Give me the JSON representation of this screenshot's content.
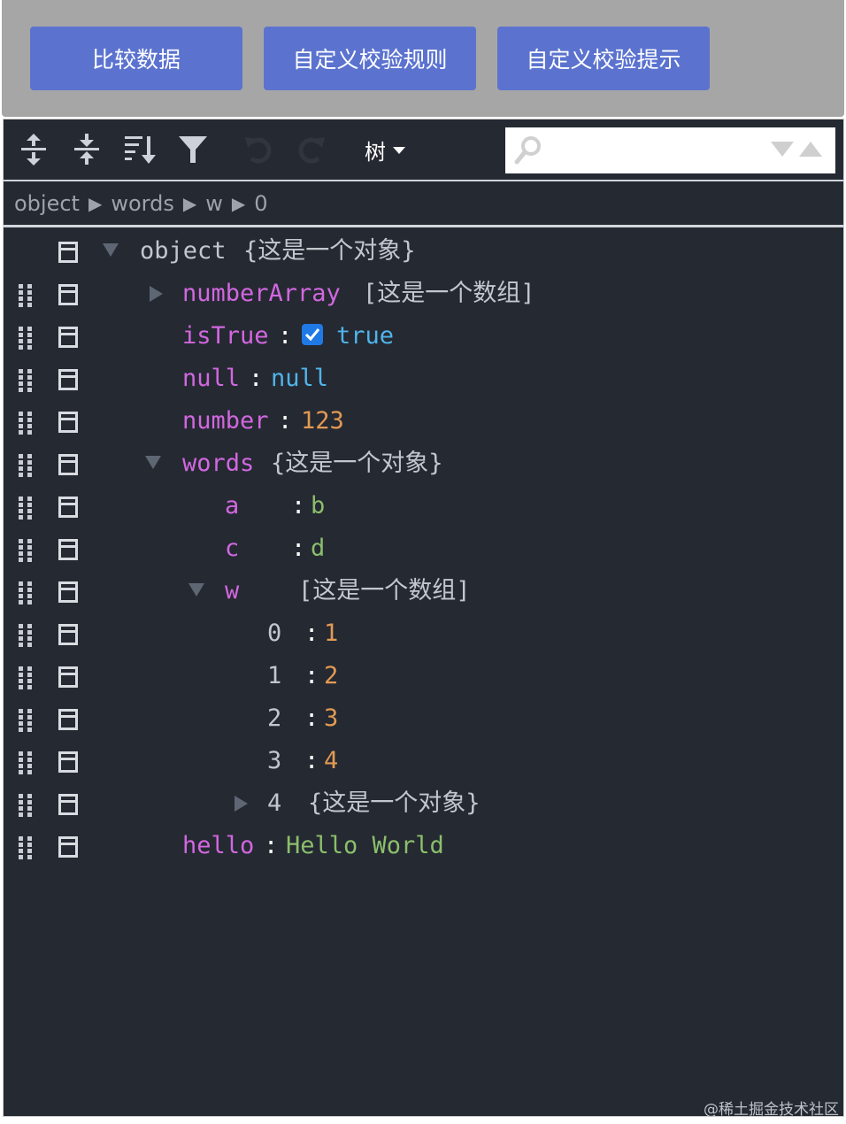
{
  "buttons": {
    "compare": "比较数据",
    "custom_rules": "自定义校验规则",
    "custom_hints": "自定义校验提示"
  },
  "menu": {
    "mode_label": "树",
    "search_placeholder": "",
    "icons": [
      "expand-all-icon",
      "collapse-all-icon",
      "sort-icon",
      "filter-icon",
      "undo-icon",
      "redo-icon"
    ]
  },
  "breadcrumb": [
    "object",
    "words",
    "w",
    "0"
  ],
  "breadcrumb_separator": "▶",
  "tree": {
    "root_key": "object",
    "root_desc": "{这是一个对象}",
    "numberArray": {
      "key": "numberArray",
      "desc": "[这是一个数组]"
    },
    "isTrue": {
      "key": "isTrue",
      "value": "true"
    },
    "null": {
      "key": "null",
      "value": "null"
    },
    "number": {
      "key": "number",
      "value": "123"
    },
    "words": {
      "key": "words",
      "desc": "{这是一个对象}",
      "a": {
        "key": "a",
        "value": "b"
      },
      "c": {
        "key": "c",
        "value": "d"
      },
      "w": {
        "key": "w",
        "desc": "[这是一个数组]",
        "items": [
          {
            "index": "0",
            "value": "1"
          },
          {
            "index": "1",
            "value": "2"
          },
          {
            "index": "2",
            "value": "3"
          },
          {
            "index": "3",
            "value": "4"
          }
        ],
        "item4": {
          "index": "4",
          "desc": "{这是一个对象}"
        }
      }
    },
    "hello": {
      "key": "hello",
      "value": "Hello World"
    },
    "separator": ":"
  },
  "colors": {
    "button_bg": "#5b73cf",
    "editor_bg": "#252932",
    "key_color": "#d267e0",
    "string_color": "#8bbf6b",
    "number_color": "#e29a53",
    "null_color": "#50b4ea"
  },
  "watermark": "@稀土掘金技术社区"
}
